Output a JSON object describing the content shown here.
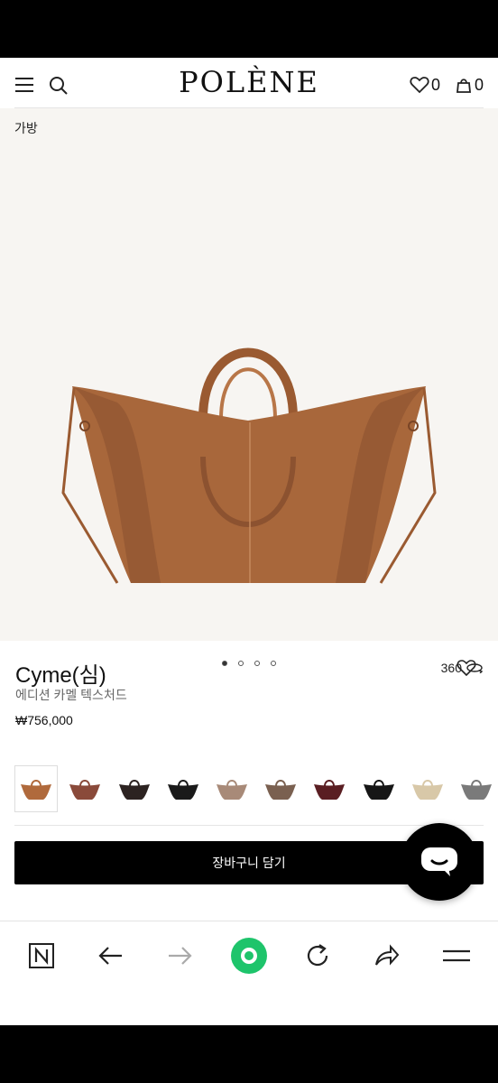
{
  "header": {
    "logo": "POLÈNE",
    "wishlist_count": "0",
    "cart_count": "0"
  },
  "breadcrumb": "가방",
  "gallery": {
    "slide_count": 4,
    "active_slide": 1,
    "view360_label": "360"
  },
  "product": {
    "title": "Cyme(심)",
    "subtitle": "에디션 카멜 텍스처드",
    "price": "₩756,000"
  },
  "swatches": [
    {
      "color": "#b06a3c",
      "selected": true
    },
    {
      "color": "#8a4a3a",
      "selected": false
    },
    {
      "color": "#2c2321",
      "selected": false
    },
    {
      "color": "#1a1a1a",
      "selected": false
    },
    {
      "color": "#a88a78",
      "selected": false
    },
    {
      "color": "#7a6050",
      "selected": false
    },
    {
      "color": "#5a1e22",
      "selected": false
    },
    {
      "color": "#161616",
      "selected": false
    },
    {
      "color": "#d8c8a8",
      "selected": false
    },
    {
      "color": "#7a7a7a",
      "selected": false
    }
  ],
  "cta": {
    "add_to_cart": "장바구니 담기"
  },
  "colors": {
    "bag": "#a8673b",
    "bag_dark": "#8c5230",
    "browser_accent": "#1ec46b"
  },
  "browser_icons": [
    "naver-n-icon",
    "back-arrow-icon",
    "forward-arrow-icon",
    "home-green-dot-icon",
    "refresh-icon",
    "share-icon",
    "menu-icon"
  ]
}
